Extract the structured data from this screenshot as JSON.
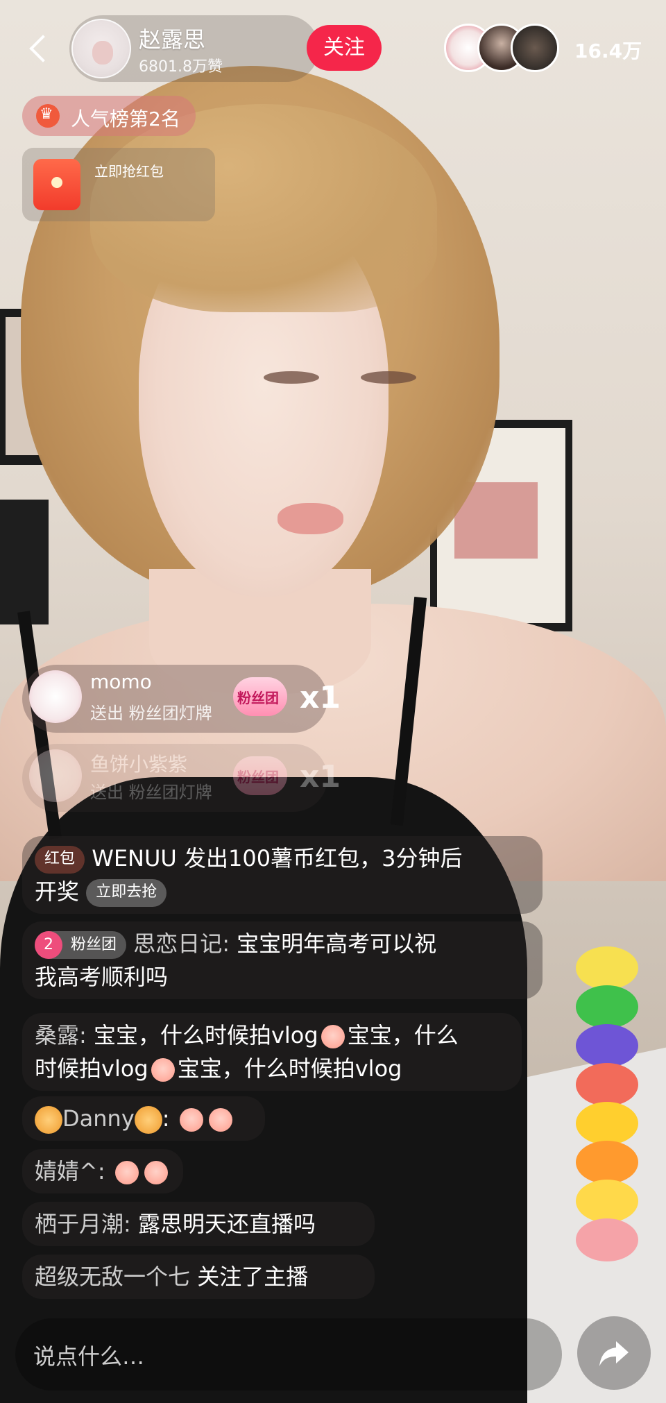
{
  "header": {
    "host_name": "赵露思",
    "host_likes": "6801.8万赞",
    "follow_label": "关注",
    "viewer_count": "16.4万"
  },
  "rank": {
    "label": "人气榜第2名"
  },
  "red_packet": {
    "label": "立即抢红包"
  },
  "gifts": [
    {
      "user": "momo",
      "action": "送出 粉丝团灯牌",
      "item": "粉丝团",
      "count": "x1"
    },
    {
      "user": "鱼饼小紫紫",
      "action": "送出 粉丝团灯牌",
      "item": "粉丝团",
      "count": "x1"
    }
  ],
  "chat": {
    "m1": {
      "tag": "红包",
      "text": "WENUU 发出100薯币红包，3分钟后",
      "text2": "开奖",
      "action": "立即去抢"
    },
    "m2": {
      "level": "2",
      "badge": "粉丝团",
      "name": "思恋日记:",
      "text": "宝宝明年高考可以祝",
      "text2": "我高考顺利吗"
    },
    "m3": {
      "name": "桑露:",
      "text": "宝宝，什么时候拍vlog",
      "text_b": "宝宝，什么",
      "text2": "时候拍vlog",
      "text2_b": "宝宝，什么时候拍vlog"
    },
    "m4": {
      "name": "Danny",
      "sep": ":"
    },
    "m5": {
      "name": "婧婧^:"
    },
    "m6": {
      "name": "栖于月潮:",
      "text": "露思明天还直播吗"
    },
    "m7": {
      "name": "超级无敌一个七",
      "text": "关注了主播"
    }
  },
  "input": {
    "placeholder": "说点什么…"
  },
  "colors": {
    "follow": "#f5264a",
    "fan_level": "#ee4d7c",
    "red_packet": "#f23b2b"
  },
  "icons": [
    "back-icon",
    "crown-icon",
    "red-packet-icon",
    "share-icon"
  ]
}
